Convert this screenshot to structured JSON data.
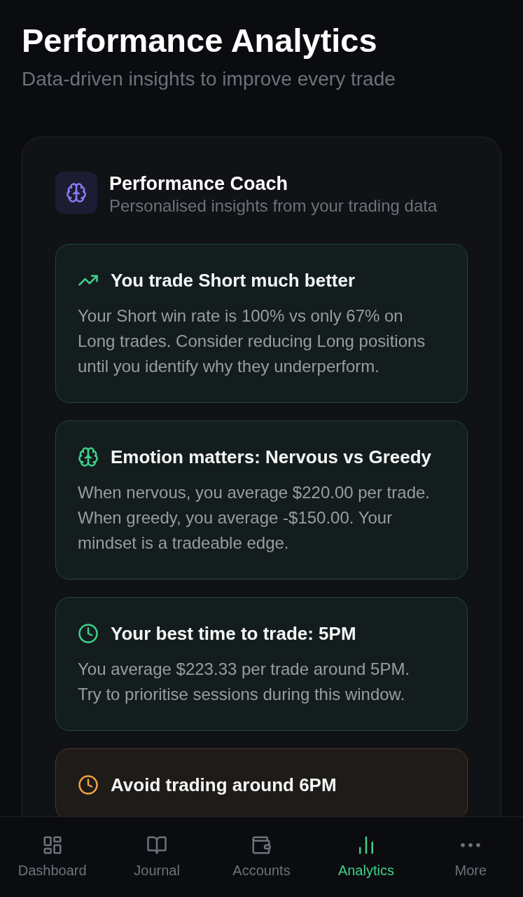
{
  "header": {
    "title": "Performance Analytics",
    "subtitle": "Data-driven insights to improve every trade"
  },
  "coach": {
    "title": "Performance Coach",
    "subtitle": "Personalised insights from your trading data",
    "insights": [
      {
        "kind": "trend",
        "color": "#3fd08c",
        "title": "You trade Short much better",
        "body": "Your Short win rate is 100% vs only 67% on Long trades. Consider reducing Long positions until you identify why they underperform."
      },
      {
        "kind": "emotion",
        "color": "#3fd08c",
        "title": "Emotion matters: Nervous vs Greedy",
        "body": "When nervous, you average $220.00 per trade. When greedy, you average -$150.00. Your mindset is a tradeable edge."
      },
      {
        "kind": "time",
        "color": "#3fd08c",
        "title": "Your best time to trade: 5PM",
        "body": "You average $223.33 per trade around 5PM. Try to prioritise sessions during this window."
      },
      {
        "kind": "time",
        "color": "#f0a340",
        "title": "Avoid trading around 6PM"
      }
    ]
  },
  "nav": {
    "items": [
      {
        "label": "Dashboard",
        "selected": false
      },
      {
        "label": "Journal",
        "selected": false
      },
      {
        "label": "Accounts",
        "selected": false
      },
      {
        "label": "Analytics",
        "selected": true
      },
      {
        "label": "More",
        "selected": false
      }
    ]
  }
}
